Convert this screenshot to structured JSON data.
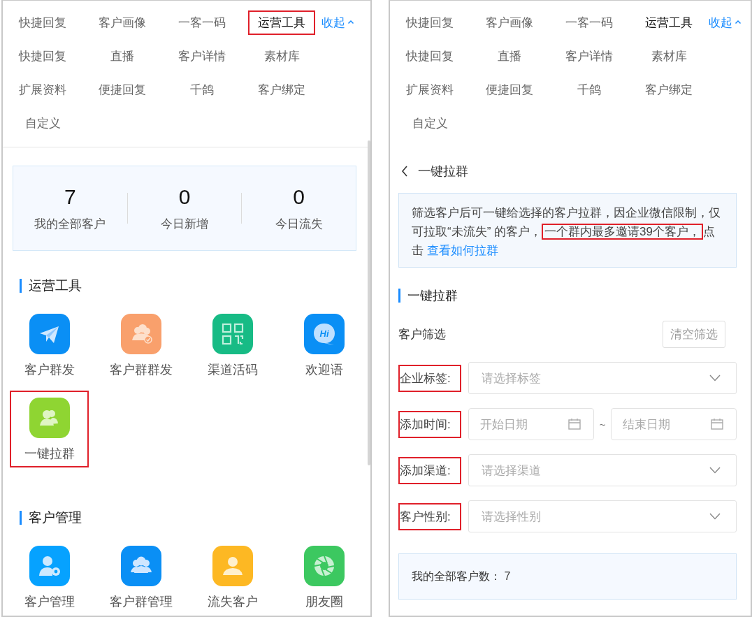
{
  "left_panel": {
    "tabs": [
      {
        "label": "快捷回复",
        "selected": false,
        "highlighted": false
      },
      {
        "label": "客户画像",
        "selected": false,
        "highlighted": false
      },
      {
        "label": "一客一码",
        "selected": false,
        "highlighted": false
      },
      {
        "label": "运营工具",
        "selected": true,
        "highlighted": true
      }
    ],
    "collapse_link": "收起",
    "sub_items": [
      "快捷回复",
      "直播",
      "客户详情",
      "素材库",
      "扩展资料",
      "便捷回复",
      "千鸽",
      "客户绑定",
      "自定义"
    ],
    "stats": [
      {
        "value": "7",
        "label": "我的全部客户"
      },
      {
        "value": "0",
        "label": "今日新增"
      },
      {
        "value": "0",
        "label": "今日流失"
      }
    ],
    "sections": [
      {
        "title": "运营工具",
        "tools": [
          {
            "label": "客户群发",
            "kind": "plane",
            "color": "#0a8ff5",
            "highlighted": false
          },
          {
            "label": "客户群群发",
            "kind": "group-check",
            "color": "#f9a06c",
            "highlighted": false
          },
          {
            "label": "渠道活码",
            "kind": "qr",
            "color": "#17bb85",
            "highlighted": false
          },
          {
            "label": "欢迎语",
            "kind": "hi",
            "icon_text": "Hi",
            "color": "#0a8ff5",
            "highlighted": false
          },
          {
            "label": "一键拉群",
            "kind": "people",
            "color": "#8fd532",
            "highlighted": true
          }
        ]
      },
      {
        "title": "客户管理",
        "tools": [
          {
            "label": "客户管理",
            "kind": "user-gear",
            "color": "#06a2ff",
            "highlighted": false
          },
          {
            "label": "客户群管理",
            "kind": "group",
            "color": "#0a8ff5",
            "highlighted": false
          },
          {
            "label": "流失客户",
            "kind": "person",
            "color": "#fdb823",
            "highlighted": false
          },
          {
            "label": "朋友圈",
            "kind": "aperture",
            "color": "#3cc860",
            "highlighted": false
          }
        ]
      }
    ]
  },
  "right_panel": {
    "tabs": [
      {
        "label": "快捷回复",
        "selected": false,
        "highlighted": false
      },
      {
        "label": "客户画像",
        "selected": false,
        "highlighted": false
      },
      {
        "label": "一客一码",
        "selected": false,
        "highlighted": false
      },
      {
        "label": "运营工具",
        "selected": true,
        "highlighted": false
      }
    ],
    "collapse_link": "收起",
    "sub_items": [
      "快捷回复",
      "直播",
      "客户详情",
      "素材库",
      "扩展资料",
      "便捷回复",
      "千鸽",
      "客户绑定",
      "自定义"
    ],
    "back_title": "一键拉群",
    "notice": {
      "segments": [
        {
          "text": "筛选客户后可一键给选择的客户拉群，因企业微信限制，仅可拉取“未流失” 的客户，",
          "highlighted": false
        },
        {
          "text": "一个群内最多邀请39个客户，",
          "highlighted": true
        },
        {
          "text": "点击 ",
          "highlighted": false
        }
      ],
      "link": "查看如何拉群"
    },
    "section_title": "一键拉群",
    "filter_label": "客户筛选",
    "clear_button": "清空筛选",
    "fields": [
      {
        "kind": "select",
        "label": "企业标签:",
        "placeholder": "请选择标签",
        "highlighted": true
      },
      {
        "kind": "date_range",
        "label": "添加时间:",
        "start_placeholder": "开始日期",
        "separator": "~",
        "end_placeholder": "结束日期",
        "highlighted": true
      },
      {
        "kind": "select",
        "label": "添加渠道:",
        "placeholder": "请选择渠道",
        "highlighted": true
      },
      {
        "kind": "select",
        "label": "客户性别:",
        "placeholder": "请选择性别",
        "highlighted": true
      }
    ],
    "total": "我的全部客户数： 7"
  }
}
